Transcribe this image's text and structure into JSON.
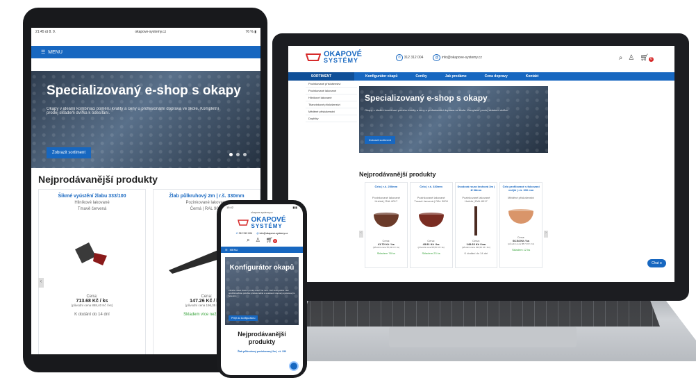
{
  "brand": {
    "line1": "OKAPOVÉ",
    "line2": "SYSTÉMY",
    "accent": "#1767c0",
    "red": "#d62a2a",
    "green": "#37a33a"
  },
  "tablet": {
    "status_time": "21:45  út 8. 9.",
    "status_url": "okapove-systemy.cz",
    "status_battery": "76 % ▮",
    "menu_label": "MENU",
    "hero_title": "Specializovaný e-shop s okapy",
    "hero_text": "Okapy v ideální kombinaci poměru kvality a ceny u profesionální doprava ve škole. Kompletní prodej skladem dvířka k odesílání.",
    "hero_button": "Zobrazit sortiment",
    "section_title": "Nejprodávanější produkty",
    "products": [
      {
        "title": "Šikmé vyústění žlabu 333/100",
        "sub1": "Hliníkové lakované",
        "sub2": "Tmavě červená",
        "price_label": "Cena:",
        "price": "713.68 Kč / ks",
        "price_note": "(původní cena 888,40 Kč / ks)",
        "stock": "K dodání do 14 dní"
      },
      {
        "title": "Žlab půlkruhový 2m | r.š. 330mm",
        "sub1": "Pozinkované lakované",
        "sub2": "Černá | RAL 9005",
        "price_label": "Cena:",
        "price": "147.26 Kč / bm",
        "price_note": "(původní cena 196,35 Kč / bm)",
        "stock": "Skladem více než 100 ks"
      }
    ]
  },
  "laptop": {
    "contact_phone": "312 312 004",
    "contact_email": "info@okapove-systemy.cz",
    "cart_count": "0",
    "nav": [
      "SORTIMENT",
      "Konfigurátor okapů",
      "Ceníky",
      "Jak prodáme",
      "Cena dopravy",
      "Kontakt"
    ],
    "sidebar": [
      "Pozinkované příslušenství",
      "Pozinkované lakované",
      "Hliníkové lakované",
      "Titanzinkové příslušenství",
      "Měděné příslušenství",
      "Doplňky"
    ],
    "hero_title": "Specializovaný e-shop s okapy",
    "hero_text": "Okapy v ideální kombinaci poměru kvality a ceny u profesionální doprava ve škole. Kompletní prodej skladem dvířka.",
    "hero_button": "Zobrazit sortiment",
    "section_title": "Nejprodávanější produkty",
    "products": [
      {
        "title": "Čelo | r.š. 250mm",
        "sub1": "Pozinkované lakované",
        "sub2": "Hnědá | RAL 8017",
        "price_label": "Cena:",
        "price": "41.72 Kč / ks",
        "price_note": "(původní cena 55,63 Kč / ks)",
        "stock": "Skladem 78 ks",
        "stock_green": true,
        "color": "#6b3b2a",
        "shape": "cap"
      },
      {
        "title": "Čelo | r.š. 330mm",
        "sub1": "Pozinkované lakované",
        "sub2": "Tmavě červená | RAL 3009",
        "price_label": "Cena:",
        "price": "43.91 Kč / ks",
        "price_note": "(původní cena 58,55 Kč / ks)",
        "stock": "Skladem 23 ks",
        "stock_green": true,
        "color": "#7a2d22",
        "shape": "cap"
      },
      {
        "title": "Svodová roura kruhová 3m | Ø 68mm",
        "sub1": "Pozinkované lakované",
        "sub2": "Hnědá | RAL 8017",
        "price_label": "Cena:",
        "price": "143.63 Kč / bm",
        "price_note": "(původní cena 191,50 Kč / bm)",
        "stock": "K dodání do 14 dní",
        "stock_green": false,
        "color": "#4b2b22",
        "shape": "pipe"
      },
      {
        "title": "Čelo profilované s falcovaní vnější | r.š. 330 mm",
        "sub1": "Měděné příslušenství",
        "sub2": "",
        "price_label": "Cena:",
        "price": "66.54 Kč / ks",
        "price_note": "(původní cena 88,72 Kč / ks)",
        "stock": "Skladem 12 ks",
        "stock_green": true,
        "color": "#d9956a",
        "shape": "cap"
      }
    ],
    "chat_label": "Chat"
  },
  "phone": {
    "status_time": "15:42",
    "url": "okapove-systemy.cz",
    "contact_phone": "312 312 004",
    "contact_email": "info@okapove-systemy.cz",
    "menu_label": "MENU",
    "hero_title": "Konfigurátor okapů",
    "hero_text": "Zbrafte získat vlastní prodej okapů na míru. Než konfigurátor vám spočítá každou položku profesionálně a sestavení dopravy systémovým řešením.",
    "hero_button": "Přejít do konfigurátoru",
    "section_title": "Nejprodávanější produkty",
    "product_title": "Žlab půlkruhový pozinkovaný 2m | r.š. 330",
    "cart_count": "0"
  }
}
